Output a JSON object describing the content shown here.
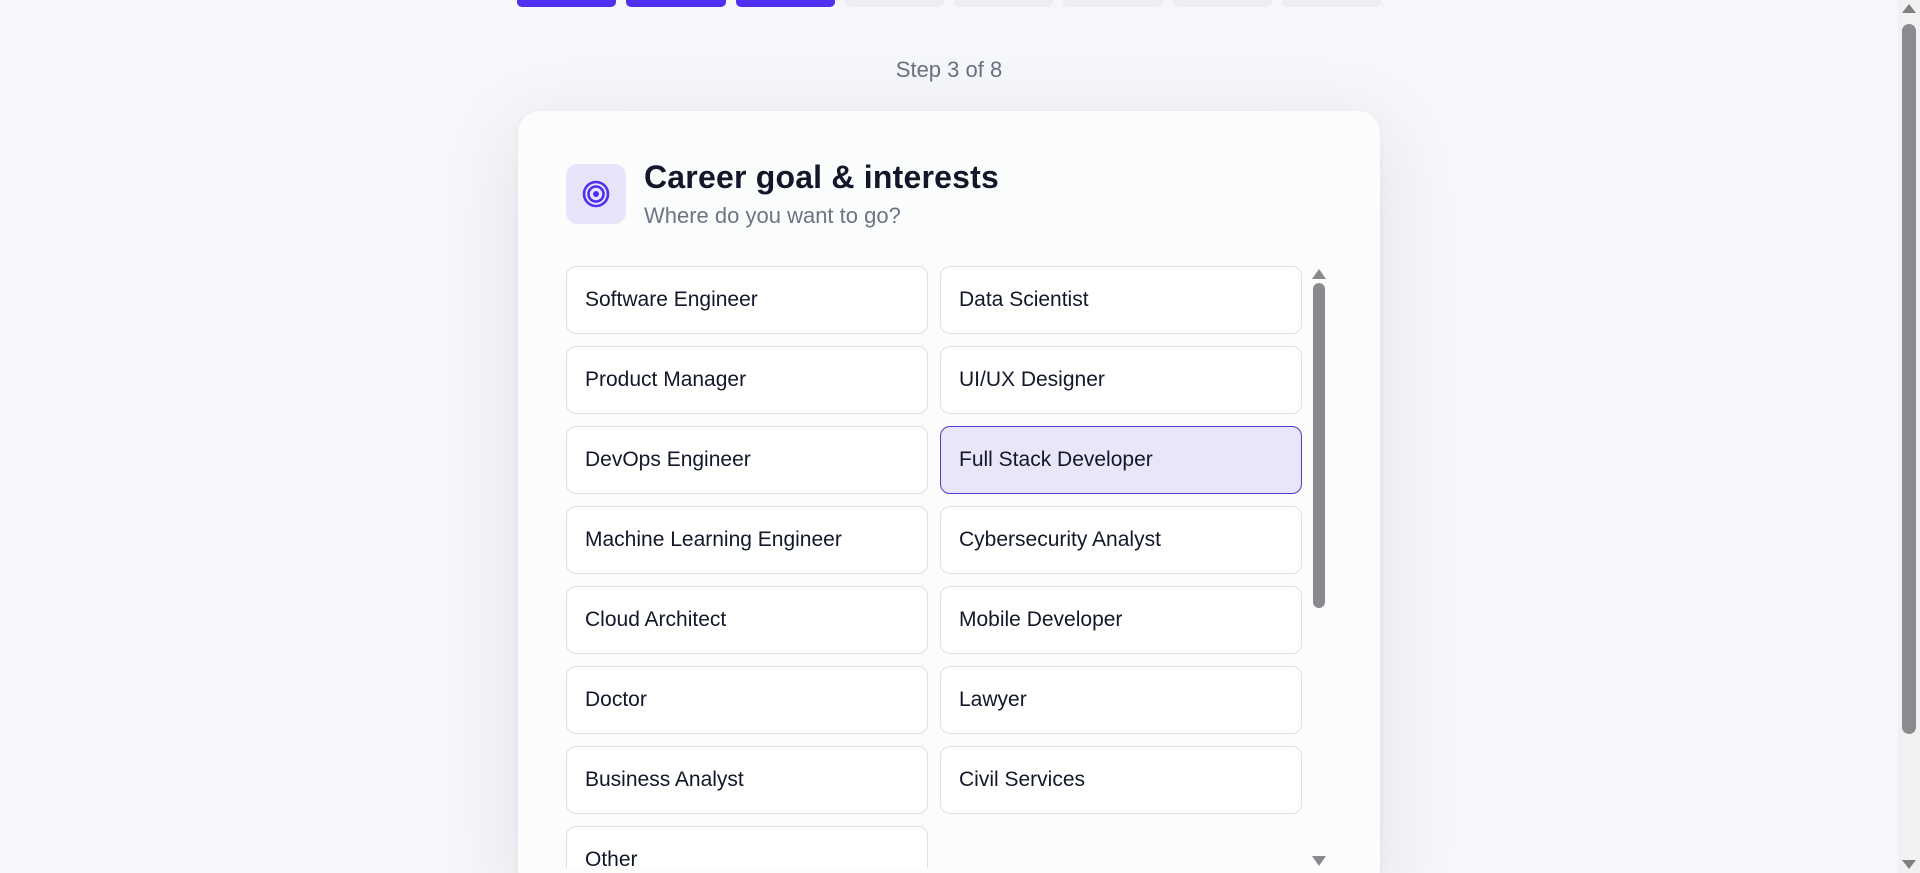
{
  "progress": {
    "total_steps": 8,
    "completed_steps": 3,
    "active_color": "#4f2ff0",
    "inactive_color": "#eceef2"
  },
  "step_label": "Step 3 of 8",
  "card": {
    "icon": "target-icon",
    "title": "Career goal & interests",
    "subtitle": "Where do you want to go?",
    "options": [
      {
        "label": "Software Engineer",
        "selected": false
      },
      {
        "label": "Data Scientist",
        "selected": false
      },
      {
        "label": "Product Manager",
        "selected": false
      },
      {
        "label": "UI/UX Designer",
        "selected": false
      },
      {
        "label": "DevOps Engineer",
        "selected": false
      },
      {
        "label": "Full Stack Developer",
        "selected": true
      },
      {
        "label": "Machine Learning Engineer",
        "selected": false
      },
      {
        "label": "Cybersecurity Analyst",
        "selected": false
      },
      {
        "label": "Cloud Architect",
        "selected": false
      },
      {
        "label": "Mobile Developer",
        "selected": false
      },
      {
        "label": "Doctor",
        "selected": false
      },
      {
        "label": "Lawyer",
        "selected": false
      },
      {
        "label": "Business Analyst",
        "selected": false
      },
      {
        "label": "Civil Services",
        "selected": false
      },
      {
        "label": "Other",
        "selected": false
      }
    ]
  },
  "colors": {
    "accent": "#4f2ff0",
    "selected_bg": "#e8e6f8",
    "selected_border": "#4f3ad1"
  }
}
